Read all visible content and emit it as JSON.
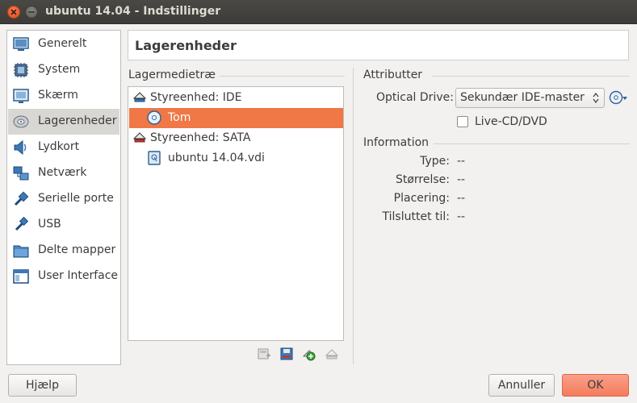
{
  "window": {
    "title": "ubuntu 14.04 - Indstillinger"
  },
  "sidebar": {
    "items": [
      {
        "label": "Generelt",
        "icon": "general-icon"
      },
      {
        "label": "System",
        "icon": "system-chip-icon"
      },
      {
        "label": "Skærm",
        "icon": "display-icon"
      },
      {
        "label": "Lagerenheder",
        "icon": "storage-icon",
        "selected": true
      },
      {
        "label": "Lydkort",
        "icon": "audio-icon"
      },
      {
        "label": "Netværk",
        "icon": "network-icon"
      },
      {
        "label": "Serielle porte",
        "icon": "serial-port-icon"
      },
      {
        "label": "USB",
        "icon": "usb-icon"
      },
      {
        "label": "Delte mapper",
        "icon": "shared-folder-icon"
      },
      {
        "label": "User Interface",
        "icon": "user-interface-icon"
      }
    ]
  },
  "header": {
    "title": "Lagerenheder"
  },
  "tree": {
    "section_label": "Lagermedietræ",
    "rows": [
      {
        "label": "Styreenhed: IDE",
        "type": "controller",
        "icon": "ide-controller-icon"
      },
      {
        "label": "Tom",
        "type": "optical",
        "icon": "optical-disc-icon",
        "selected": true
      },
      {
        "label": "Styreenhed: SATA",
        "type": "controller",
        "icon": "sata-controller-icon"
      },
      {
        "label": "ubuntu 14.04.vdi",
        "type": "disk",
        "icon": "hard-disk-icon"
      }
    ]
  },
  "toolbar": {
    "buttons": [
      {
        "icon": "add-controller-icon"
      },
      {
        "icon": "remove-controller-icon"
      },
      {
        "icon": "add-attachment-icon"
      },
      {
        "icon": "remove-attachment-icon"
      }
    ]
  },
  "attributes": {
    "section_label": "Attributter",
    "optical_drive_label": "Optical Drive:",
    "optical_drive_value": "Sekundær IDE-master",
    "live_cd_label": "Live-CD/DVD",
    "live_cd_checked": false
  },
  "information": {
    "section_label": "Information",
    "fields": [
      {
        "key": "Type:",
        "value": "--"
      },
      {
        "key": "Størrelse:",
        "value": "--"
      },
      {
        "key": "Placering:",
        "value": "--"
      },
      {
        "key": "Tilsluttet til:",
        "value": "--"
      }
    ]
  },
  "buttons": {
    "help": "Hjælp",
    "cancel": "Annuller",
    "ok": "OK"
  },
  "colors": {
    "accent": "#f07746",
    "ok_button": "#f47c5c",
    "titlebar": "#3c3b37"
  }
}
